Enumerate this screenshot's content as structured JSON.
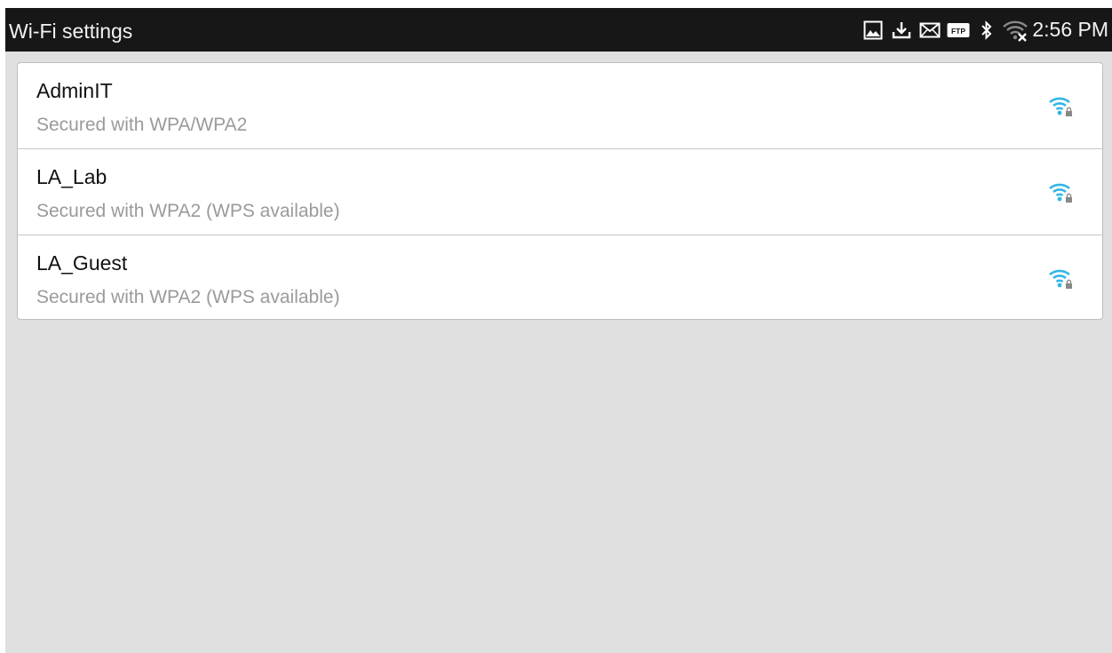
{
  "status_bar": {
    "title": "Wi-Fi settings",
    "time": "2:56 PM",
    "icons": [
      "picture-icon",
      "download-icon",
      "mail-icon",
      "ftp-icon",
      "bluetooth-icon",
      "wifi-disconnected-icon"
    ],
    "ftp_label": "FTP"
  },
  "networks": [
    {
      "name": "AdminIT",
      "security": "Secured with WPA/WPA2",
      "icon": "wifi-lock-icon"
    },
    {
      "name": "LA_Lab",
      "security": "Secured with WPA2 (WPS available)",
      "icon": "wifi-lock-icon"
    },
    {
      "name": "LA_Guest",
      "security": "Secured with WPA2 (WPS available)",
      "icon": "wifi-lock-icon"
    }
  ],
  "colors": {
    "status_bar_bg": "#171717",
    "background": "#e0e0e0",
    "wifi_accent": "#33b5e5",
    "secondary_text": "#9a9a9a"
  }
}
